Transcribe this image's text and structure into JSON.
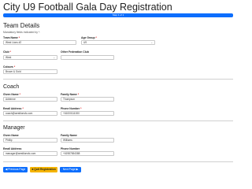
{
  "page_title": "City U9 Football Gala Day Registration",
  "progress": {
    "label": "Step 1 of 1",
    "percent": 100,
    "color": "#0d6efd"
  },
  "team": {
    "title": "Team Details",
    "subtitle": "Mandatory fields indicated by *.",
    "team_name_label": "Team Name",
    "team_name_value": "West Lions #2",
    "age_group_label": "Age Group",
    "age_group_value": "U9",
    "club_label": "Club",
    "club_value": "West",
    "other_club_label": "Other Federation Club",
    "other_club_value": "",
    "colours_label": "Colours",
    "colours_value": "Brown & Gold"
  },
  "coach": {
    "title": "Coach",
    "given_name_label": "Given Name",
    "given_name_value": "Adrienne",
    "family_name_label": "Family Name",
    "family_name_value": "Thompson",
    "email_label": "Email Address",
    "email_value": "coach@westlionsfc.com",
    "phone_label": "Phone Number",
    "phone_value": "+61000111000"
  },
  "manager": {
    "title": "Manager",
    "given_name_label": "Given Name",
    "given_name_value": "Phillip",
    "family_name_label": "Family Name",
    "family_name_value": "Williams",
    "email_label": "Email Address",
    "email_value": "manager@westlionsfc.com",
    "phone_label": "Phone Number",
    "phone_value": "+61987654388"
  },
  "buttons": {
    "previous": "Previous Page",
    "quit": "Quit Registration",
    "next": "Next Page"
  },
  "icons": {
    "previous": "arrow-left-icon",
    "quit": "stop-icon",
    "next": "arrow-right-icon"
  },
  "required_marker": "*"
}
